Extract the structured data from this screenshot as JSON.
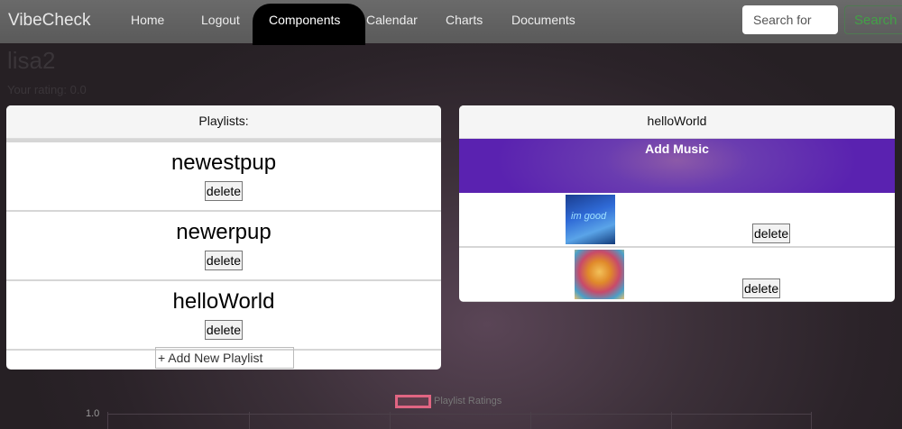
{
  "nav": {
    "brand": "VibeCheck",
    "items": [
      "Home",
      "Logout",
      "Components",
      "Calendar",
      "Charts",
      "Documents"
    ],
    "search_placeholder": "Search for",
    "search_button": "Search"
  },
  "user": {
    "name": "lisa2",
    "rating": "Your rating: 0.0"
  },
  "playlists": {
    "header": "Playlists:",
    "items": [
      {
        "name": "newestpup",
        "delete_label": "delete"
      },
      {
        "name": "newerpup",
        "delete_label": "delete"
      },
      {
        "name": "helloWorld",
        "delete_label": "delete"
      }
    ],
    "add_label": "+ Add New Playlist"
  },
  "selected_playlist": {
    "title": "helloWorld",
    "add_music_label": "Add Music",
    "songs": [
      {
        "art_text": "im good",
        "delete_label": "delete"
      },
      {
        "art_text": "",
        "delete_label": "delete"
      }
    ]
  },
  "chart_data": {
    "type": "line",
    "title": "",
    "series": [
      {
        "name": "Playlist Ratings",
        "values": []
      }
    ],
    "y_ticks": [
      "1.0"
    ],
    "legend_position": "top-center",
    "legend_color": "#e06582"
  }
}
